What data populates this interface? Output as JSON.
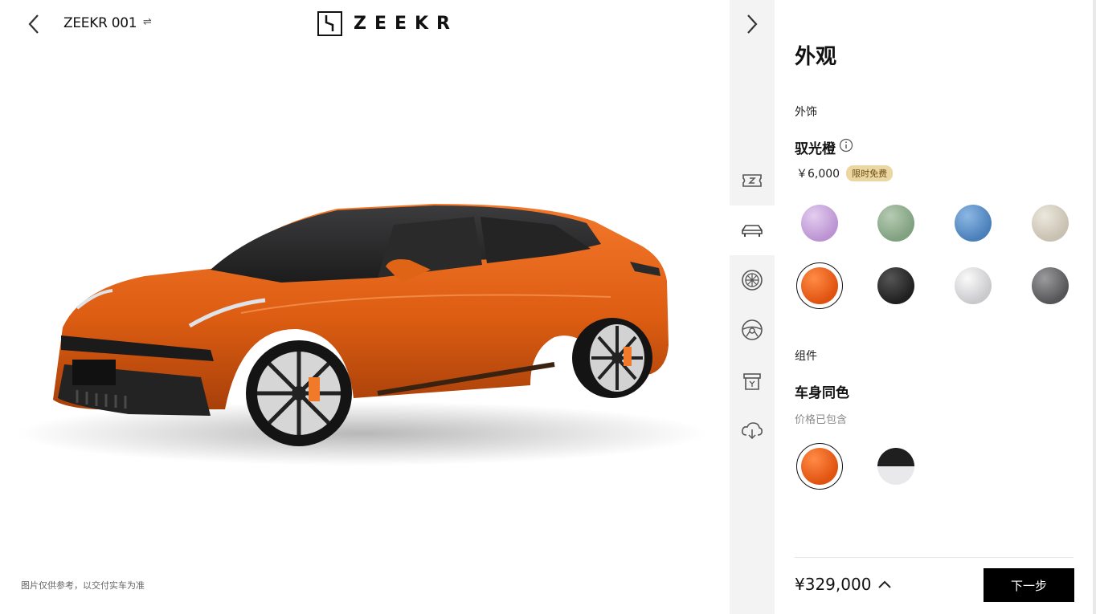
{
  "header": {
    "model_name": "ZEEKR 001",
    "swap_symbol": "⇌",
    "brand_name": "ZEEKR"
  },
  "stage": {
    "disclaimer": "图片仅供参考，以交付实车为准"
  },
  "nav": {
    "items": [
      {
        "icon": "ticket-icon",
        "active": false
      },
      {
        "icon": "car-exterior-icon",
        "active": true
      },
      {
        "icon": "wheel-icon",
        "active": false
      },
      {
        "icon": "steering-wheel-icon",
        "active": false
      },
      {
        "icon": "package-icon",
        "active": false
      },
      {
        "icon": "cloud-download-icon",
        "active": false
      }
    ]
  },
  "panel": {
    "title": "外观",
    "exterior": {
      "section_label": "外饰",
      "selected_color": "驭光橙",
      "price": "￥6,000",
      "badge": "限时免费",
      "swatches": [
        {
          "color": "#c9a6dc",
          "selected": false
        },
        {
          "color": "#93ad92",
          "selected": false
        },
        {
          "color": "#5a8fc8",
          "selected": false
        },
        {
          "color": "#d9d3c6",
          "selected": false
        },
        {
          "color": "#ee5a15",
          "selected": true
        },
        {
          "color": "#2e2e2e",
          "selected": false
        },
        {
          "color": "#dcdcde",
          "selected": false
        },
        {
          "color": "#6c6c6e",
          "selected": false
        }
      ]
    },
    "components": {
      "section_label": "组件",
      "selected_name": "车身同色",
      "note": "价格已包含",
      "swatches": [
        {
          "color": "#ee5a15",
          "selected": true
        },
        {
          "color": "two-tone-black-white",
          "selected": false
        }
      ]
    },
    "footer": {
      "total_price": "¥329,000",
      "next_label": "下一步"
    }
  },
  "colors": {
    "accent_orange": "#ee5a15",
    "badge_bg": "#ecd6a2",
    "nav_bg": "#f3f3f4",
    "button_bg": "#000000"
  }
}
